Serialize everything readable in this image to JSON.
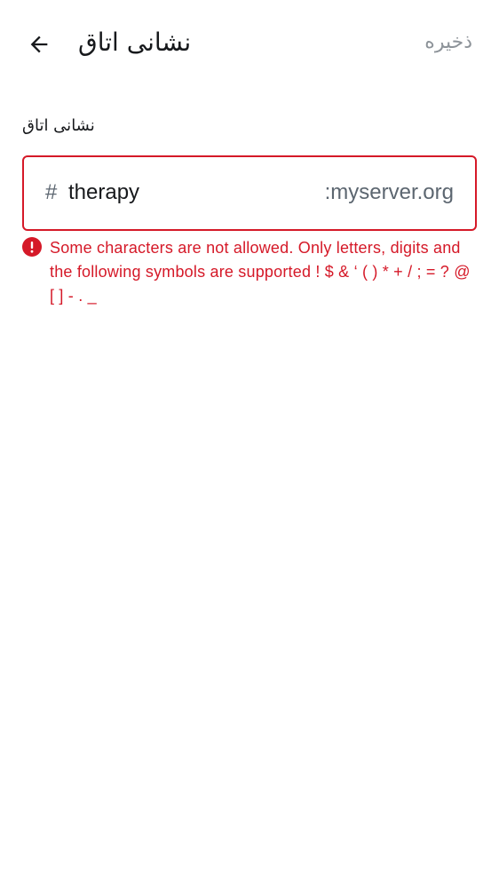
{
  "header": {
    "title": "نشانی اتاق",
    "save_label": "ذخیره",
    "back_icon": "arrow-left-icon"
  },
  "address_field": {
    "label": "نشانی اتاق",
    "prefix": "#",
    "value": "therapy",
    "suffix": ":myserver.org"
  },
  "error": {
    "icon": "error-icon",
    "message": "Some characters are not allowed. Only letters, digits and the following symbols are supported ! $ & ‘ ( ) * + / ; = ? @ [ ] - . _"
  },
  "colors": {
    "error": "#d51928",
    "muted": "#8d9399",
    "text": "#17191c"
  }
}
